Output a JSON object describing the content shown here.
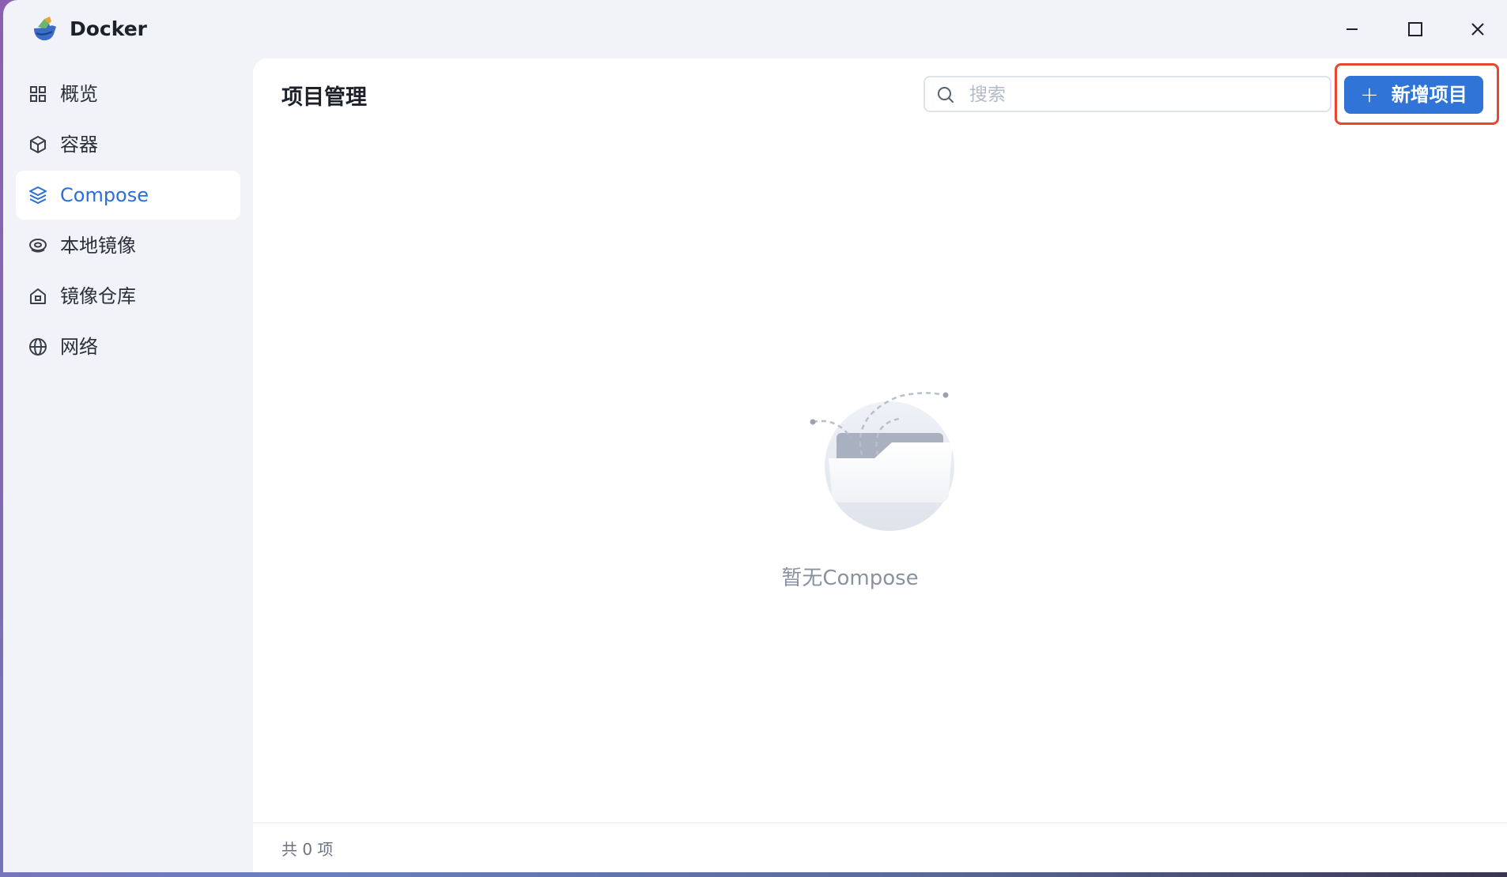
{
  "app": {
    "title": "Docker"
  },
  "window_controls": {
    "minimize_icon": "minimize-icon",
    "maximize_icon": "maximize-icon",
    "close_icon": "close-icon"
  },
  "sidebar": {
    "items": [
      {
        "label": "概览",
        "icon": "grid-icon",
        "active": false
      },
      {
        "label": "容器",
        "icon": "cube-icon",
        "active": false
      },
      {
        "label": "Compose",
        "icon": "layers-icon",
        "active": true
      },
      {
        "label": "本地镜像",
        "icon": "eye-disk-icon",
        "active": false
      },
      {
        "label": "镜像仓库",
        "icon": "home-icon",
        "active": false
      },
      {
        "label": "网络",
        "icon": "globe-icon",
        "active": false
      }
    ]
  },
  "main": {
    "title": "项目管理",
    "search": {
      "placeholder": "搜索",
      "value": ""
    },
    "add_button": {
      "icon": "plus",
      "label": "新增项目"
    },
    "empty": {
      "icon": "empty-folder-icon",
      "text": "暂无Compose"
    },
    "footer": {
      "count_text": "共 0 项"
    }
  },
  "colors": {
    "accent": "#2f74d6",
    "highlight": "#e8472f",
    "window_bg": "#f1f3f8"
  }
}
